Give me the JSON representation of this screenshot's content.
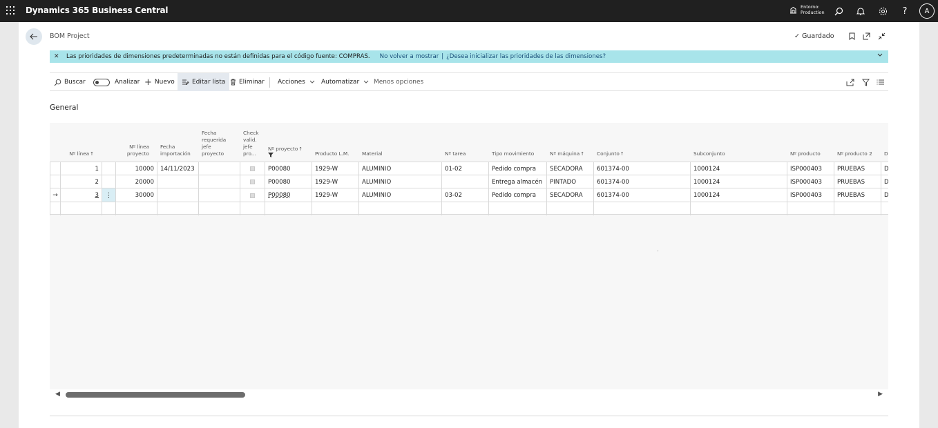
{
  "app": {
    "title": "Dynamics 365 Business Central",
    "environment_label": "Entorno:",
    "environment_value": "Production",
    "avatar_initial": "A"
  },
  "page": {
    "title": "BOM Project",
    "saved_label": "Guardado"
  },
  "notification": {
    "message": "Las prioridades de dimensiones predeterminadas no están definidas para el código fuente: COMPRAS.",
    "dismiss_link": "No volver a mostrar",
    "separator": "|",
    "init_link": "¿Desea inicializar las prioridades de las dimensiones?"
  },
  "actions": {
    "search": "Buscar",
    "analyze": "Analizar",
    "new": "Nuevo",
    "edit_list": "Editar lista",
    "delete": "Eliminar",
    "actions_menu": "Acciones",
    "automate": "Automatizar",
    "fewer_options": "Menos opciones"
  },
  "section": {
    "title": "General"
  },
  "grid": {
    "headers": {
      "line_no": "Nº línea",
      "project_line_no_1": "Nº línea",
      "project_line_no_2": "proyecto",
      "import_date_1": "Fecha",
      "import_date_2": "importación",
      "required_date_1": "Fecha",
      "required_date_2": "requerida",
      "required_date_3": "jefe",
      "required_date_4": "proyecto",
      "check_1": "Check",
      "check_2": "valid.",
      "check_3": "jefe",
      "check_4": "pro...",
      "project_no": "Nº proyecto",
      "product_lm": "Producto L.M.",
      "material": "Material",
      "task_no": "Nº tarea",
      "movement_type": "Tipo movimiento",
      "machine_no": "Nº máquina",
      "assembly": "Conjunto",
      "subassembly": "Subconjunto",
      "product_no": "Nº producto",
      "product_no_2": "Nº producto 2",
      "desc_truncated": "D"
    },
    "rows": [
      {
        "line_no": "1",
        "project_line": "10000",
        "import_date": "14/11/2023",
        "project_no": "P00080",
        "product_lm": "1929-W",
        "material": "ALUMINIO",
        "task_no": "01-02",
        "movement_type": "Pedido compra",
        "machine_no": "SECADORA",
        "assembly": "601374-00",
        "subassembly": "1000124",
        "product_no": "ISP000403",
        "product_no_2": "PRUEBAS",
        "desc": "D"
      },
      {
        "line_no": "2",
        "project_line": "20000",
        "import_date": "",
        "project_no": "P00080",
        "product_lm": "1929-W",
        "material": "ALUMINIO",
        "task_no": "",
        "movement_type": "Entrega almacén",
        "machine_no": "PINTADO",
        "assembly": "601374-00",
        "subassembly": "1000124",
        "product_no": "ISP000403",
        "product_no_2": "PRUEBAS",
        "desc": "D"
      },
      {
        "line_no": "3",
        "project_line": "30000",
        "import_date": "",
        "project_no": "P00080",
        "product_lm": "1929-W",
        "material": "ALUMINIO",
        "task_no": "03-02",
        "movement_type": "Pedido compra",
        "machine_no": "SECADORA",
        "assembly": "601374-00",
        "subassembly": "1000124",
        "product_no": "ISP000403",
        "product_no_2": "PRUEBAS",
        "desc": "D"
      }
    ]
  },
  "icons": {
    "waffle": "app-launcher-icon",
    "back": "back-arrow-icon",
    "search": "search-icon",
    "bell": "notification-icon",
    "settings": "gear-icon",
    "help": "help-icon",
    "bookmark": "bookmark-icon",
    "open_new": "open-new-window-icon",
    "collapse": "collapse-icon",
    "share": "share-icon",
    "filter": "filter-icon",
    "list": "list-view-icon"
  },
  "colors": {
    "topbar": "#202020",
    "notification": "#a8e4ea",
    "selected_action": "#e4e9ef",
    "row_menu": "#d9eef5"
  }
}
